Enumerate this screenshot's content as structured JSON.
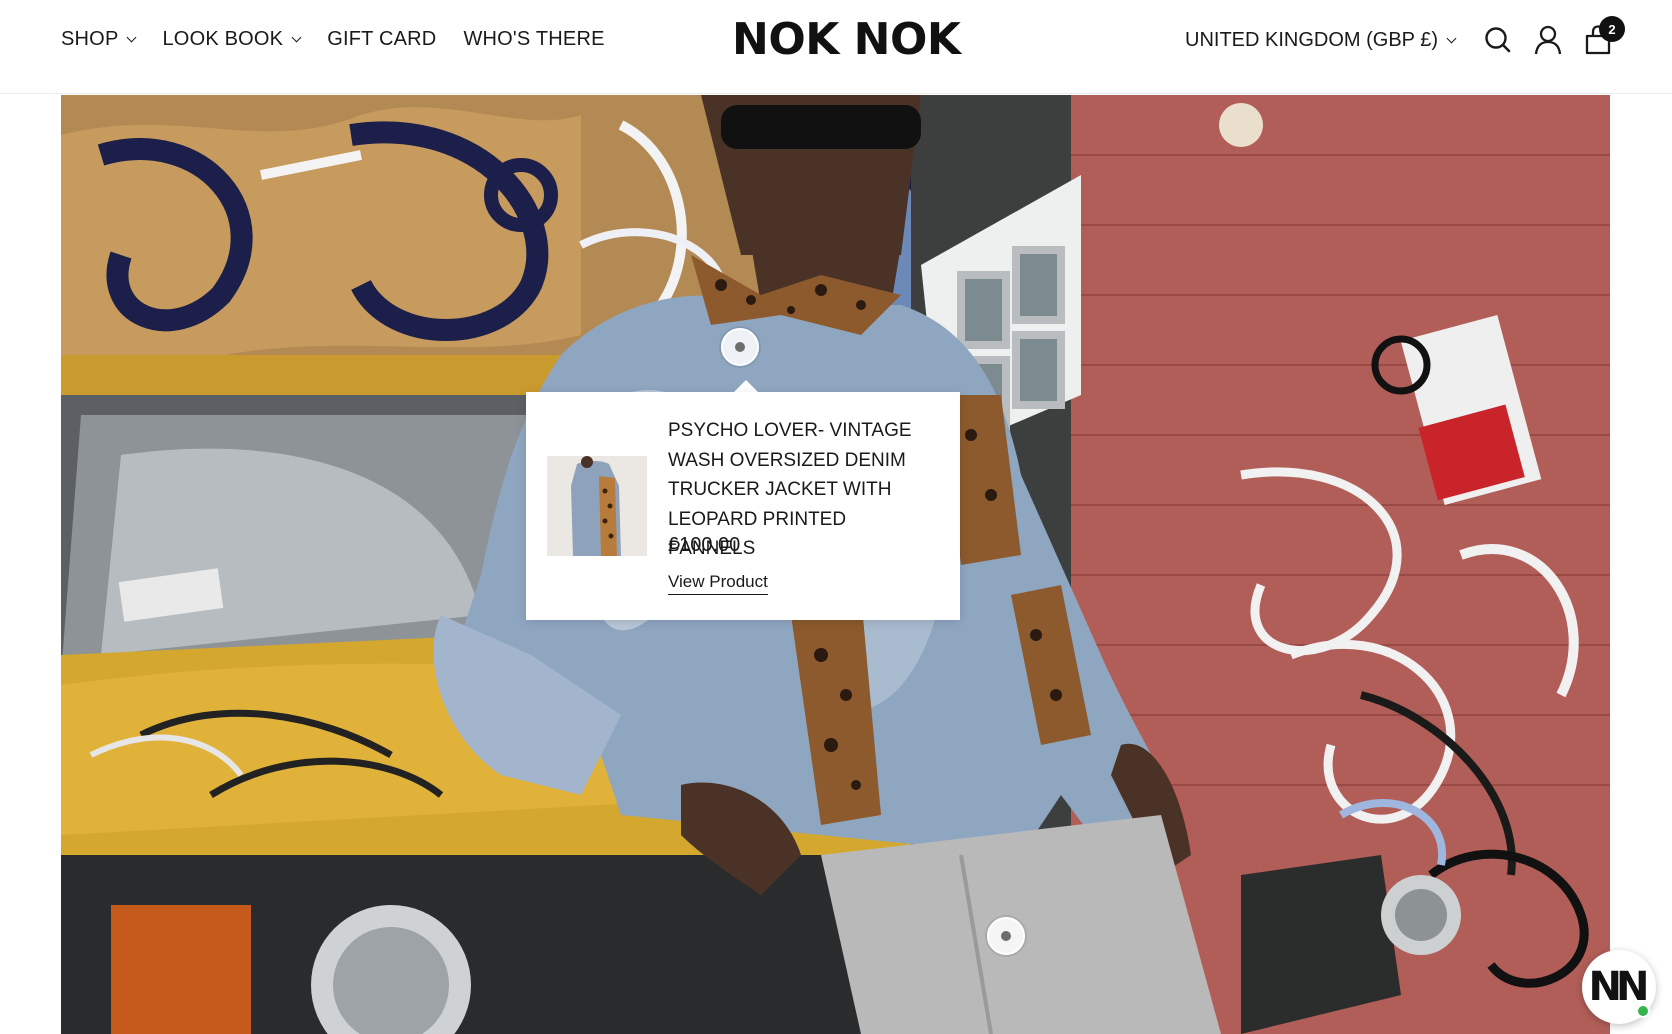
{
  "header": {
    "nav": [
      {
        "label": "SHOP",
        "has_dropdown": true
      },
      {
        "label": "LOOK BOOK",
        "has_dropdown": true
      },
      {
        "label": "GIFT CARD",
        "has_dropdown": false
      },
      {
        "label": "WHO'S THERE",
        "has_dropdown": false
      }
    ],
    "logo": "NOK NOK",
    "currency": "UNITED KINGDOM (GBP £)",
    "icons": [
      "search-icon",
      "account-icon",
      "cart-icon"
    ],
    "cart_count": "2"
  },
  "hotspot_popup": {
    "title": "PSYCHO LOVER- VINTAGE WASH OVERSIZED DENIM TRUCKER JACKET WITH LEOPARD PRINTED PANNELS",
    "price": "£100.00",
    "link_label": "View Product"
  },
  "chat_widget": {
    "label": "NN",
    "online_color": "#36b24a"
  },
  "colors": {
    "text": "#1a1a1a",
    "background": "#ffffff",
    "badge": "#111111"
  }
}
